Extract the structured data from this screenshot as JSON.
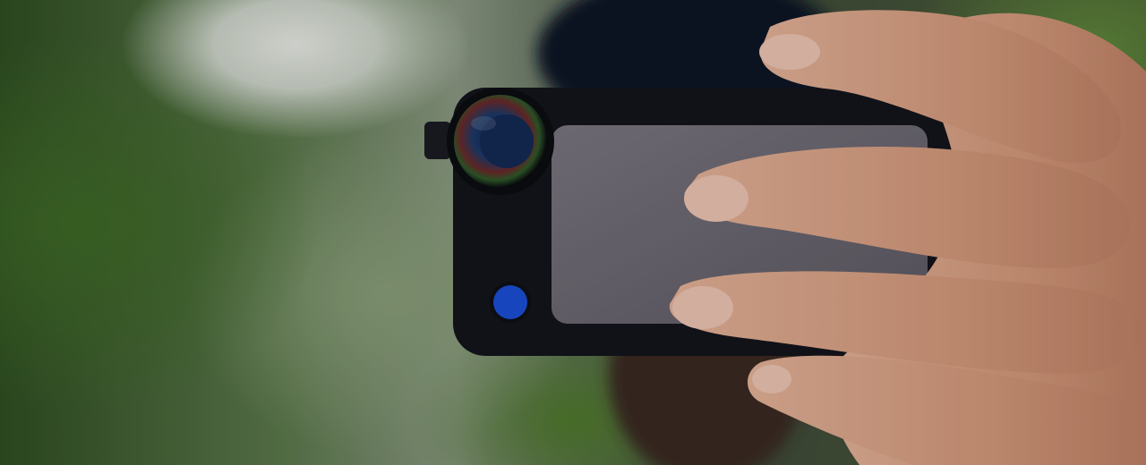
{
  "scene": {
    "description_icon": "hand-holding-phone-with-lens",
    "colors": {
      "lens_ring": "#0c0d12",
      "lens_glass": "#1d3a6a",
      "case_body": "#14151c",
      "phone_back": "#6f6b75",
      "shutter_button": "#1b4fd8",
      "skin": "#d9a184"
    }
  }
}
